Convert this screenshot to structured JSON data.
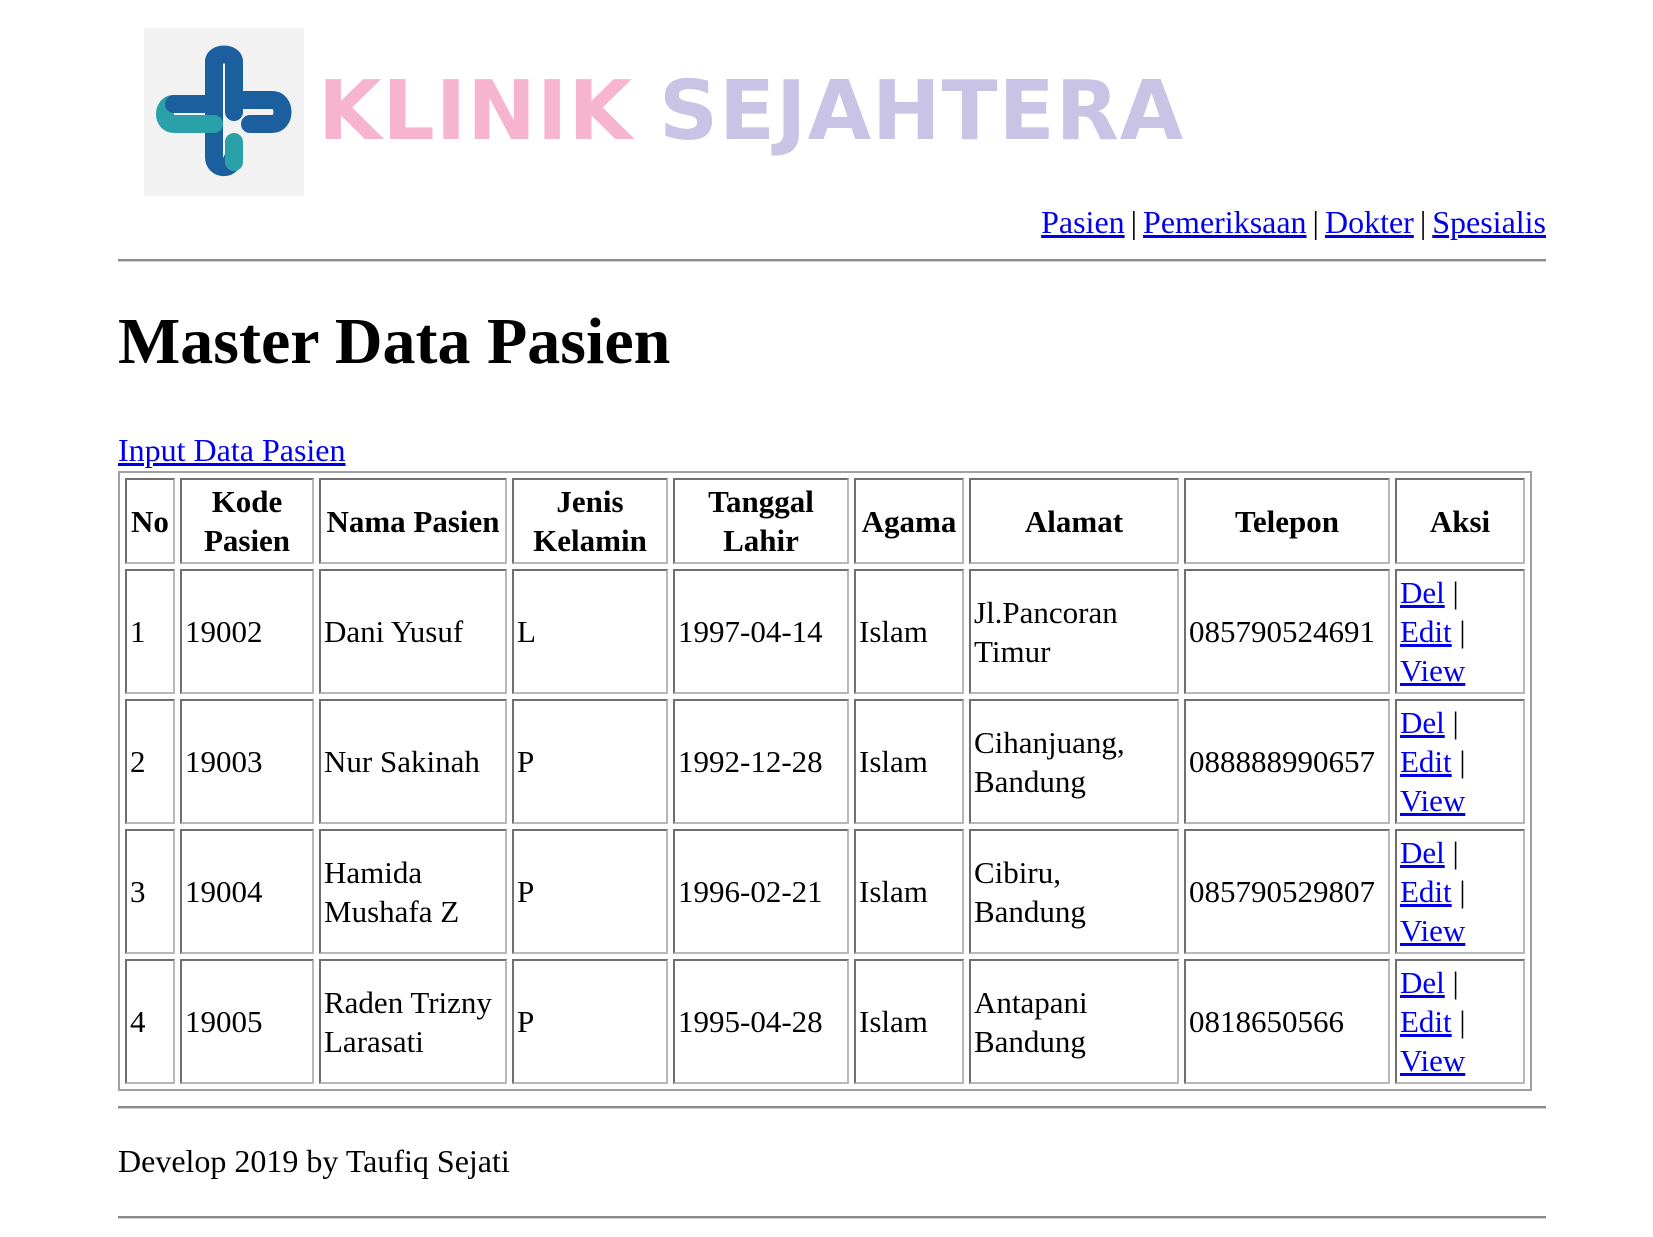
{
  "header": {
    "logo_text_1": "KLINIK",
    "logo_text_2": "SEJAHTERA",
    "colors": {
      "logo_word_1": "#f7b4cf",
      "logo_word_2": "#c9c3e6",
      "logo_mark_blue": "#1b5f9e",
      "logo_mark_teal": "#2aa1a8",
      "link": "#0000ee"
    }
  },
  "nav": {
    "items": [
      {
        "label": "Pasien"
      },
      {
        "label": "Pemeriksaan"
      },
      {
        "label": "Dokter"
      },
      {
        "label": "Spesialis"
      }
    ],
    "separator": "|"
  },
  "main": {
    "title": "Master Data Pasien",
    "input_link": "Input Data Pasien",
    "table": {
      "columns": [
        "No",
        "Kode Pasien",
        "Nama Pasien",
        "Jenis Kelamin",
        "Tanggal Lahir",
        "Agama",
        "Alamat",
        "Telepon",
        "Aksi"
      ],
      "rows": [
        {
          "no": "1",
          "kode": "19002",
          "nama": "Dani Yusuf",
          "jk": "L",
          "tgl": "1997-04-14",
          "agama": "Islam",
          "alamat": "Jl.Pancoran Timur",
          "telp": "085790524691"
        },
        {
          "no": "2",
          "kode": "19003",
          "nama": "Nur Sakinah",
          "jk": "P",
          "tgl": "1992-12-28",
          "agama": "Islam",
          "alamat": "Cihanjuang, Bandung",
          "telp": "088888990657"
        },
        {
          "no": "3",
          "kode": "19004",
          "nama": "Hamida Mushafa Z",
          "jk": "P",
          "tgl": "1996-02-21",
          "agama": "Islam",
          "alamat": "Cibiru, Bandung",
          "telp": "085790529807"
        },
        {
          "no": "4",
          "kode": "19005",
          "nama": "Raden Trizny Larasati",
          "jk": "P",
          "tgl": "1995-04-28",
          "agama": "Islam",
          "alamat": "Antapani Bandung",
          "telp": "0818650566"
        }
      ],
      "actions": {
        "del": "Del",
        "edit": "Edit",
        "view": "View",
        "separator": "|"
      }
    }
  },
  "footer": {
    "text": "Develop 2019 by Taufiq Sejati"
  }
}
